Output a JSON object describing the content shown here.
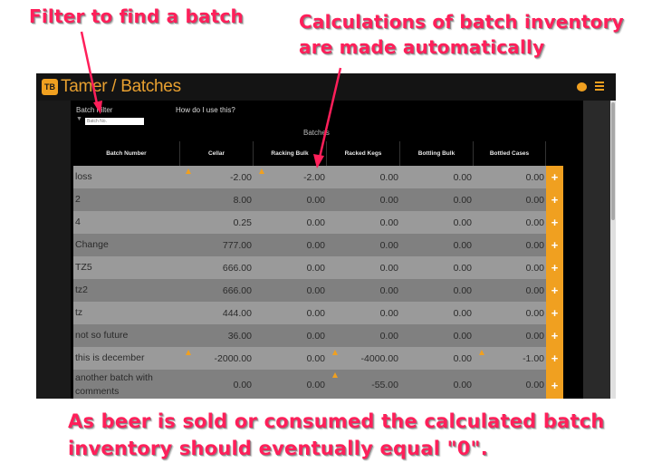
{
  "annotations": {
    "filter": "Filter to find a batch",
    "calc_line1": "Calculations of batch inventory",
    "calc_line2": "are made automatically",
    "bottom_line1": "As beer is sold or consumed the calculated batch",
    "bottom_line2": "inventory should eventually equal \"0\"."
  },
  "app": {
    "title": "Tamer / Batches",
    "logo": "TB",
    "chat_icon": "chat-bubble-icon",
    "menu_icon": "hamburger-menu-icon"
  },
  "filter": {
    "label": "Batch Filter",
    "placeholder": "Batch No.",
    "icon": "filter-funnel-icon"
  },
  "help_link": "How do I use this?",
  "table": {
    "title": "Batches",
    "columns": [
      "Batch Number",
      "Cellar",
      "Racking Bulk",
      "Racked Kegs",
      "Bottling Bulk",
      "Bottled Cases"
    ],
    "rows": [
      {
        "name": "loss",
        "values": [
          "-2.00",
          "-2.00",
          "0.00",
          "0.00",
          "0.00"
        ]
      },
      {
        "name": "2",
        "values": [
          "8.00",
          "0.00",
          "0.00",
          "0.00",
          "0.00"
        ]
      },
      {
        "name": "4",
        "values": [
          "0.25",
          "0.00",
          "0.00",
          "0.00",
          "0.00"
        ]
      },
      {
        "name": "Change",
        "values": [
          "777.00",
          "0.00",
          "0.00",
          "0.00",
          "0.00"
        ]
      },
      {
        "name": "TZ5",
        "values": [
          "666.00",
          "0.00",
          "0.00",
          "0.00",
          "0.00"
        ]
      },
      {
        "name": "tz2",
        "values": [
          "666.00",
          "0.00",
          "0.00",
          "0.00",
          "0.00"
        ]
      },
      {
        "name": "tz",
        "values": [
          "444.00",
          "0.00",
          "0.00",
          "0.00",
          "0.00"
        ]
      },
      {
        "name": "not so future",
        "values": [
          "36.00",
          "0.00",
          "0.00",
          "0.00",
          "0.00"
        ]
      },
      {
        "name": "this is december",
        "values": [
          "-2000.00",
          "0.00",
          "-4000.00",
          "0.00",
          "-1.00"
        ]
      },
      {
        "name": "another batch with comments",
        "values": [
          "0.00",
          "0.00",
          "-55.00",
          "0.00",
          "0.00"
        ]
      }
    ],
    "add_label": "+",
    "warn_icon": "warning-triangle-icon",
    "add_icon": "plus-icon",
    "colors": {
      "accent": "#f0a020",
      "row_light": "#9a9a9a",
      "row_dark": "#808080"
    }
  }
}
